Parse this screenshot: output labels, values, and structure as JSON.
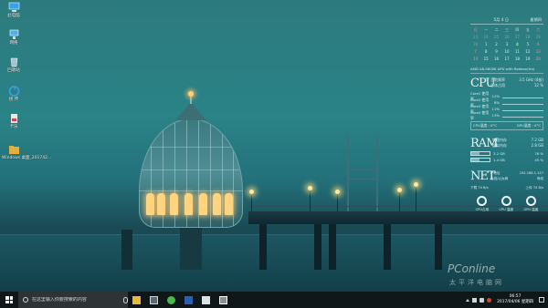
{
  "desktop_icons": [
    {
      "label": "此电脑",
      "icon": "computer-icon"
    },
    {
      "label": "网络",
      "icon": "network-icon"
    },
    {
      "label": "回收站",
      "icon": "recycle-bin-icon"
    },
    {
      "label": "接 传",
      "icon": "transfer-icon"
    },
    {
      "label": "卡乐",
      "icon": "shortcut-icon"
    },
    {
      "label": "Windows 桌面_201742...",
      "icon": "folder-icon"
    }
  ],
  "calendar": {
    "header_left": "",
    "header_mid": "5月  4 日",
    "header_right": "星期四",
    "weekdays": [
      "日",
      "一",
      "二",
      "三",
      "四",
      "五",
      "六"
    ],
    "days": [
      "23",
      "24",
      "25",
      "26",
      "27",
      "28",
      "29",
      "30",
      "1",
      "2",
      "3",
      "4",
      "5",
      "6",
      "7",
      "8",
      "9",
      "10",
      "11",
      "12",
      "13",
      "14",
      "15",
      "16",
      "17",
      "18",
      "19",
      "20"
    ],
    "today": "4"
  },
  "cpu": {
    "model": "AMD A8-5600K APU with Radeon(tm)",
    "big": "CPU",
    "freq_label": "当前频率",
    "freq_value": "3.5 GHz (4核)",
    "usage_label": "总体占用",
    "usage_value": "12 %",
    "cores": [
      {
        "name": "Core1 使用率",
        "value": "12%"
      },
      {
        "name": "Core2 使用率",
        "value": "8%"
      },
      {
        "name": "Core3 使用率",
        "value": "11%"
      },
      {
        "name": "Core4 使用率",
        "value": "13%"
      }
    ],
    "cpu_temp": "CPU温度 : 0°C",
    "gpu_temp": "GPU温度 : 0°C"
  },
  "ram": {
    "big": "RAM",
    "rows": [
      {
        "bar_text": "",
        "label": "物理内存",
        "value": "7.2 GB",
        "fill": 0.0
      },
      {
        "bar_text": "",
        "label": "虚拟内存",
        "value": "2.8 GB",
        "fill": 0.0
      },
      {
        "bar_text": "3.2 GB",
        "label": "",
        "value": "76 %",
        "fill": 0.45
      },
      {
        "bar_text": "1.4 GB",
        "label": "",
        "value": "45 %",
        "fill": 0.45
      }
    ]
  },
  "net": {
    "big": "NET",
    "rows": [
      {
        "label": "IP地址",
        "value": "192.168.1.157"
      },
      {
        "label": "无线/以太网",
        "value": "有线"
      },
      {
        "label": "",
        "value": ""
      }
    ],
    "down_label": "下载",
    "down_value": "74 B/s",
    "up_label": "上传",
    "up_value": "74 B/s"
  },
  "gauges": [
    {
      "label": "",
      "sub": "CPU占用"
    },
    {
      "label": "",
      "sub": "CPU 温度"
    },
    {
      "label": "",
      "sub": "GPU 温度"
    }
  ],
  "watermark": {
    "main": "PConline",
    "sub": "太平洋电脑网"
  },
  "taskbar": {
    "search_placeholder": "在这里输入你要搜索的内容",
    "apps": [
      "file-explorer-icon",
      "calculator-icon",
      "browser-icon",
      "word-icon",
      "photos-icon",
      "media-icon"
    ],
    "clock_time": "06:57",
    "clock_date": "2017/04/06 星期四"
  },
  "colors": {
    "accent": "#2a8387",
    "taskbar": "#0f1719",
    "weekend": "#ff8c8c",
    "today": "#7dff7d"
  }
}
